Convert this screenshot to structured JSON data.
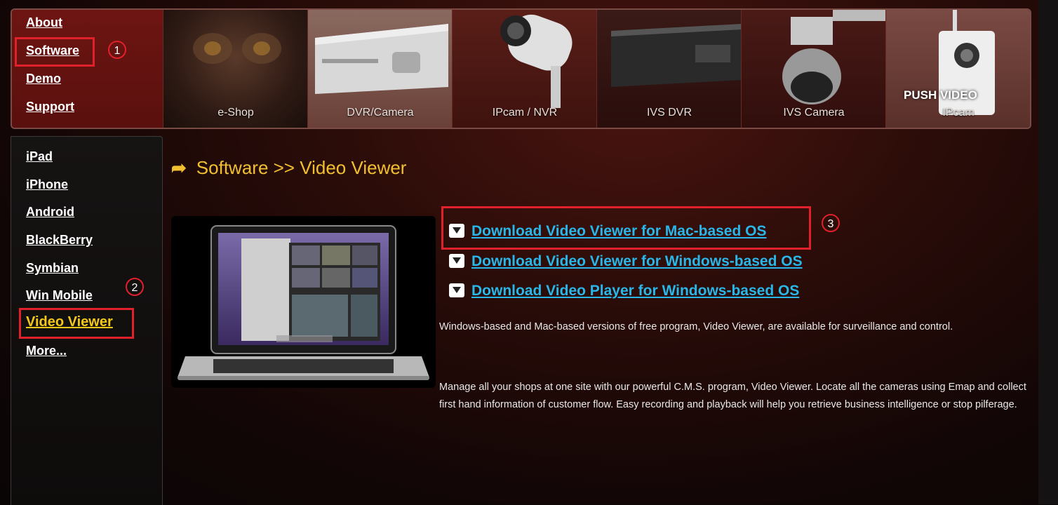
{
  "top_nav": {
    "about": "About",
    "software": "Software",
    "demo": "Demo",
    "support": "Support"
  },
  "products": [
    {
      "label": "e-Shop"
    },
    {
      "label": "DVR/Camera"
    },
    {
      "label": "IPcam / NVR"
    },
    {
      "label": "IVS DVR"
    },
    {
      "label": "IVS Camera"
    },
    {
      "label": "IPcam",
      "overlay": "PUSH VIDEO"
    }
  ],
  "sidebar": {
    "items": [
      {
        "label": "iPad"
      },
      {
        "label": "iPhone"
      },
      {
        "label": "Android"
      },
      {
        "label": "BlackBerry"
      },
      {
        "label": "Symbian"
      },
      {
        "label": "Win Mobile"
      },
      {
        "label": "Video Viewer"
      },
      {
        "label": "More..."
      }
    ]
  },
  "annotations": {
    "one": "1",
    "two": "2",
    "three": "3"
  },
  "breadcrumb": "Software >> Video Viewer",
  "downloads": [
    {
      "label": "Download Video Viewer for Mac-based OS"
    },
    {
      "label": "Download Video Viewer for Windows-based OS"
    },
    {
      "label": "Download Video Player for Windows-based OS"
    }
  ],
  "description": {
    "p1": "Windows-based and Mac-based versions of free program, Video Viewer, are available for surveillance and control.",
    "p2": "Manage all your shops at one site with our powerful C.M.S. program, Video Viewer. Locate all the cameras using Emap and collect first hand information of customer flow. Easy recording and playback will help you retrieve business intelligence or stop pilferage."
  },
  "colors": {
    "accent_yellow": "#f3c818",
    "link_blue": "#29b6e8",
    "highlight_red": "#e0202a"
  }
}
